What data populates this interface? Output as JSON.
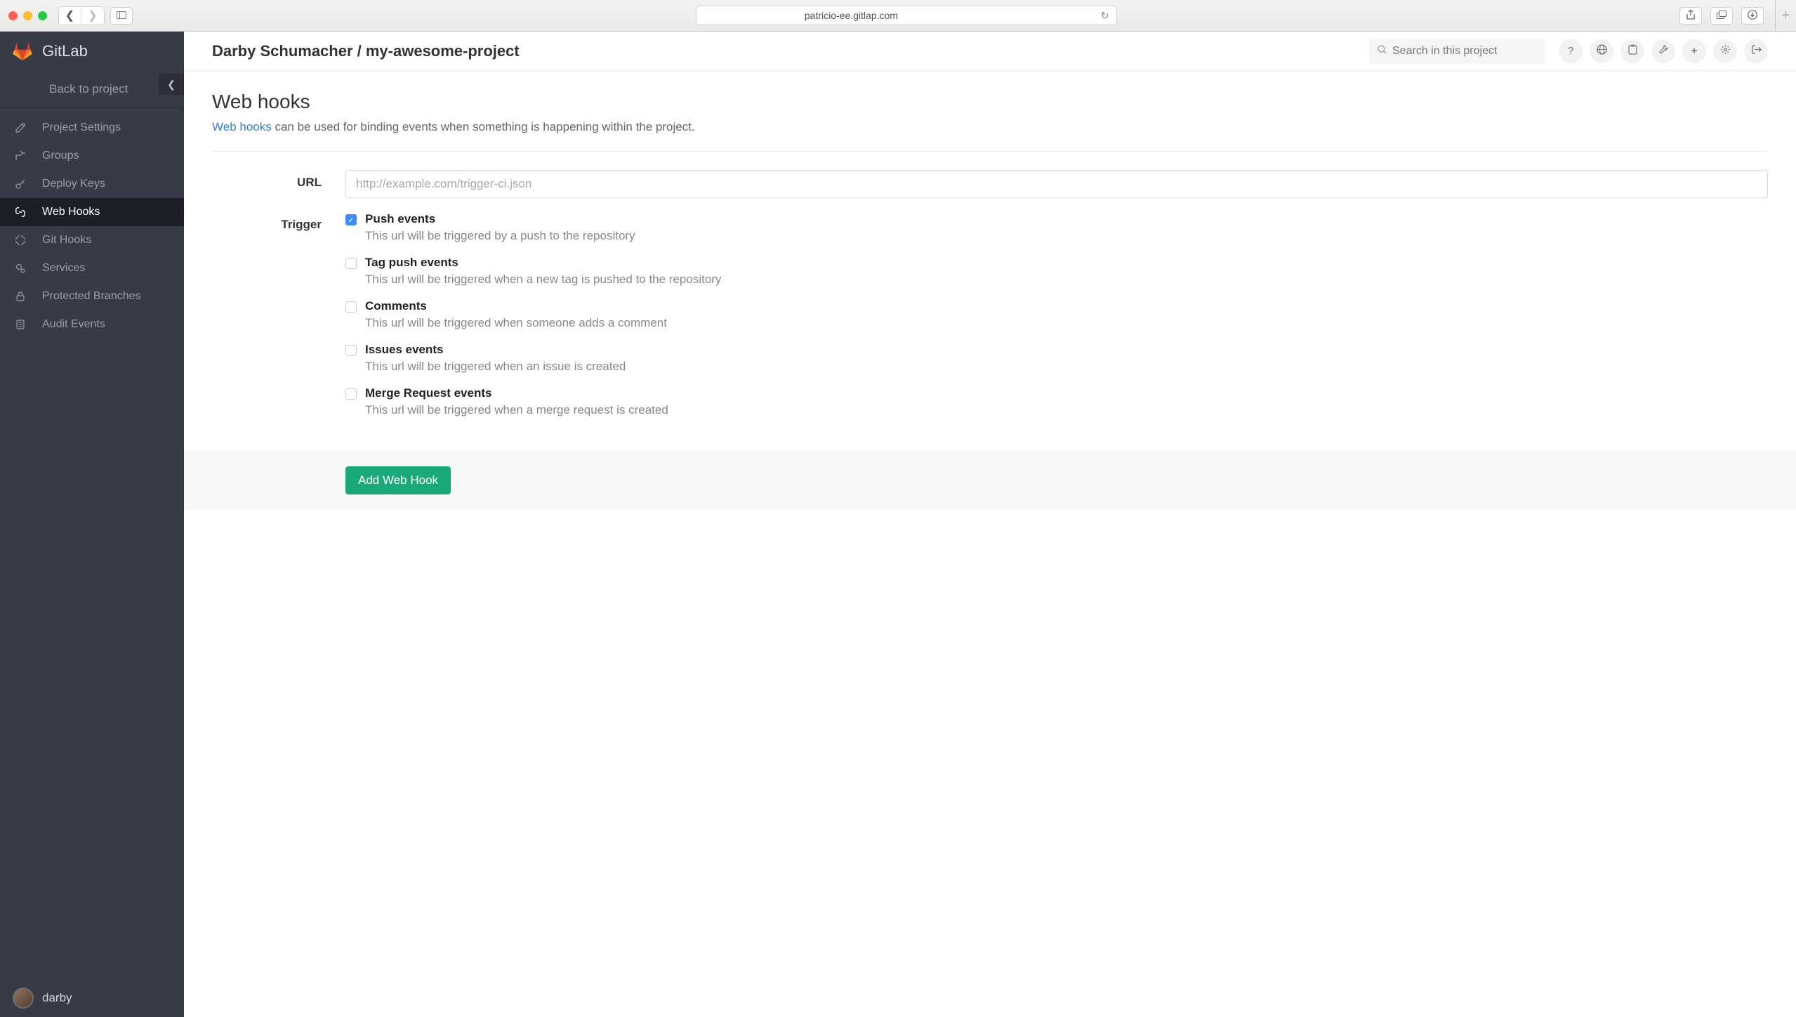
{
  "browser": {
    "url": "patricio-ee.gitlap.com"
  },
  "sidebar": {
    "app_name": "GitLab",
    "back_label": "Back to project",
    "items": [
      {
        "label": "Project Settings"
      },
      {
        "label": "Groups"
      },
      {
        "label": "Deploy Keys"
      },
      {
        "label": "Web Hooks"
      },
      {
        "label": "Git Hooks"
      },
      {
        "label": "Services"
      },
      {
        "label": "Protected Branches"
      },
      {
        "label": "Audit Events"
      }
    ],
    "username": "darby"
  },
  "header": {
    "breadcrumb": "Darby Schumacher / my-awesome-project",
    "search_placeholder": "Search in this project"
  },
  "page": {
    "title": "Web hooks",
    "desc_link": "Web hooks",
    "desc_rest": " can be used for binding events when something is happening within the project."
  },
  "form": {
    "url_label": "URL",
    "url_placeholder": "http://example.com/trigger-ci.json",
    "trigger_label": "Trigger",
    "triggers": [
      {
        "title": "Push events",
        "desc": "This url will be triggered by a push to the repository",
        "checked": true
      },
      {
        "title": "Tag push events",
        "desc": "This url will be triggered when a new tag is pushed to the repository",
        "checked": false
      },
      {
        "title": "Comments",
        "desc": "This url will be triggered when someone adds a comment",
        "checked": false
      },
      {
        "title": "Issues events",
        "desc": "This url will be triggered when an issue is created",
        "checked": false
      },
      {
        "title": "Merge Request events",
        "desc": "This url will be triggered when a merge request is created",
        "checked": false
      }
    ],
    "submit_label": "Add Web Hook"
  }
}
